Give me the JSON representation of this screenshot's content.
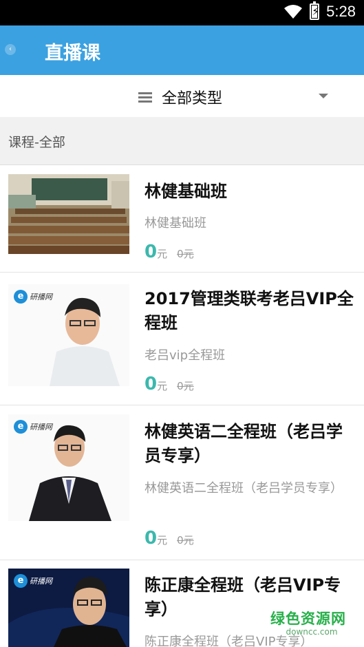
{
  "status_bar": {
    "time": "5:28"
  },
  "header": {
    "title": "直播课"
  },
  "filter": {
    "label": "全部类型"
  },
  "section": {
    "label": "课程-全部"
  },
  "courses": [
    {
      "name": "林健基础班",
      "subtitle": "林健基础班",
      "price": "0",
      "unit": "元",
      "original_price": "0元"
    },
    {
      "name": "2017管理类联考老吕VIP全程班",
      "subtitle": "老吕vip全程班",
      "price": "0",
      "unit": "元",
      "original_price": "0元",
      "logo_text": "研播网"
    },
    {
      "name": "林健英语二全程班（老吕学员专享）",
      "subtitle": "林健英语二全程班（老吕学员专享）",
      "price": "0",
      "unit": "元",
      "original_price": "0元",
      "logo_text": "研播网"
    },
    {
      "name": "陈正康全程班（老吕VIP专享）",
      "subtitle": "陈正康全程班（老吕VIP专享）",
      "logo_text": "研播网"
    }
  ],
  "watermark": {
    "title": "绿色资源网",
    "domain": "downcc.com"
  },
  "colors": {
    "appbar": "#3ba1e1",
    "price": "#3cb8ad",
    "watermark": "#27b04a"
  }
}
